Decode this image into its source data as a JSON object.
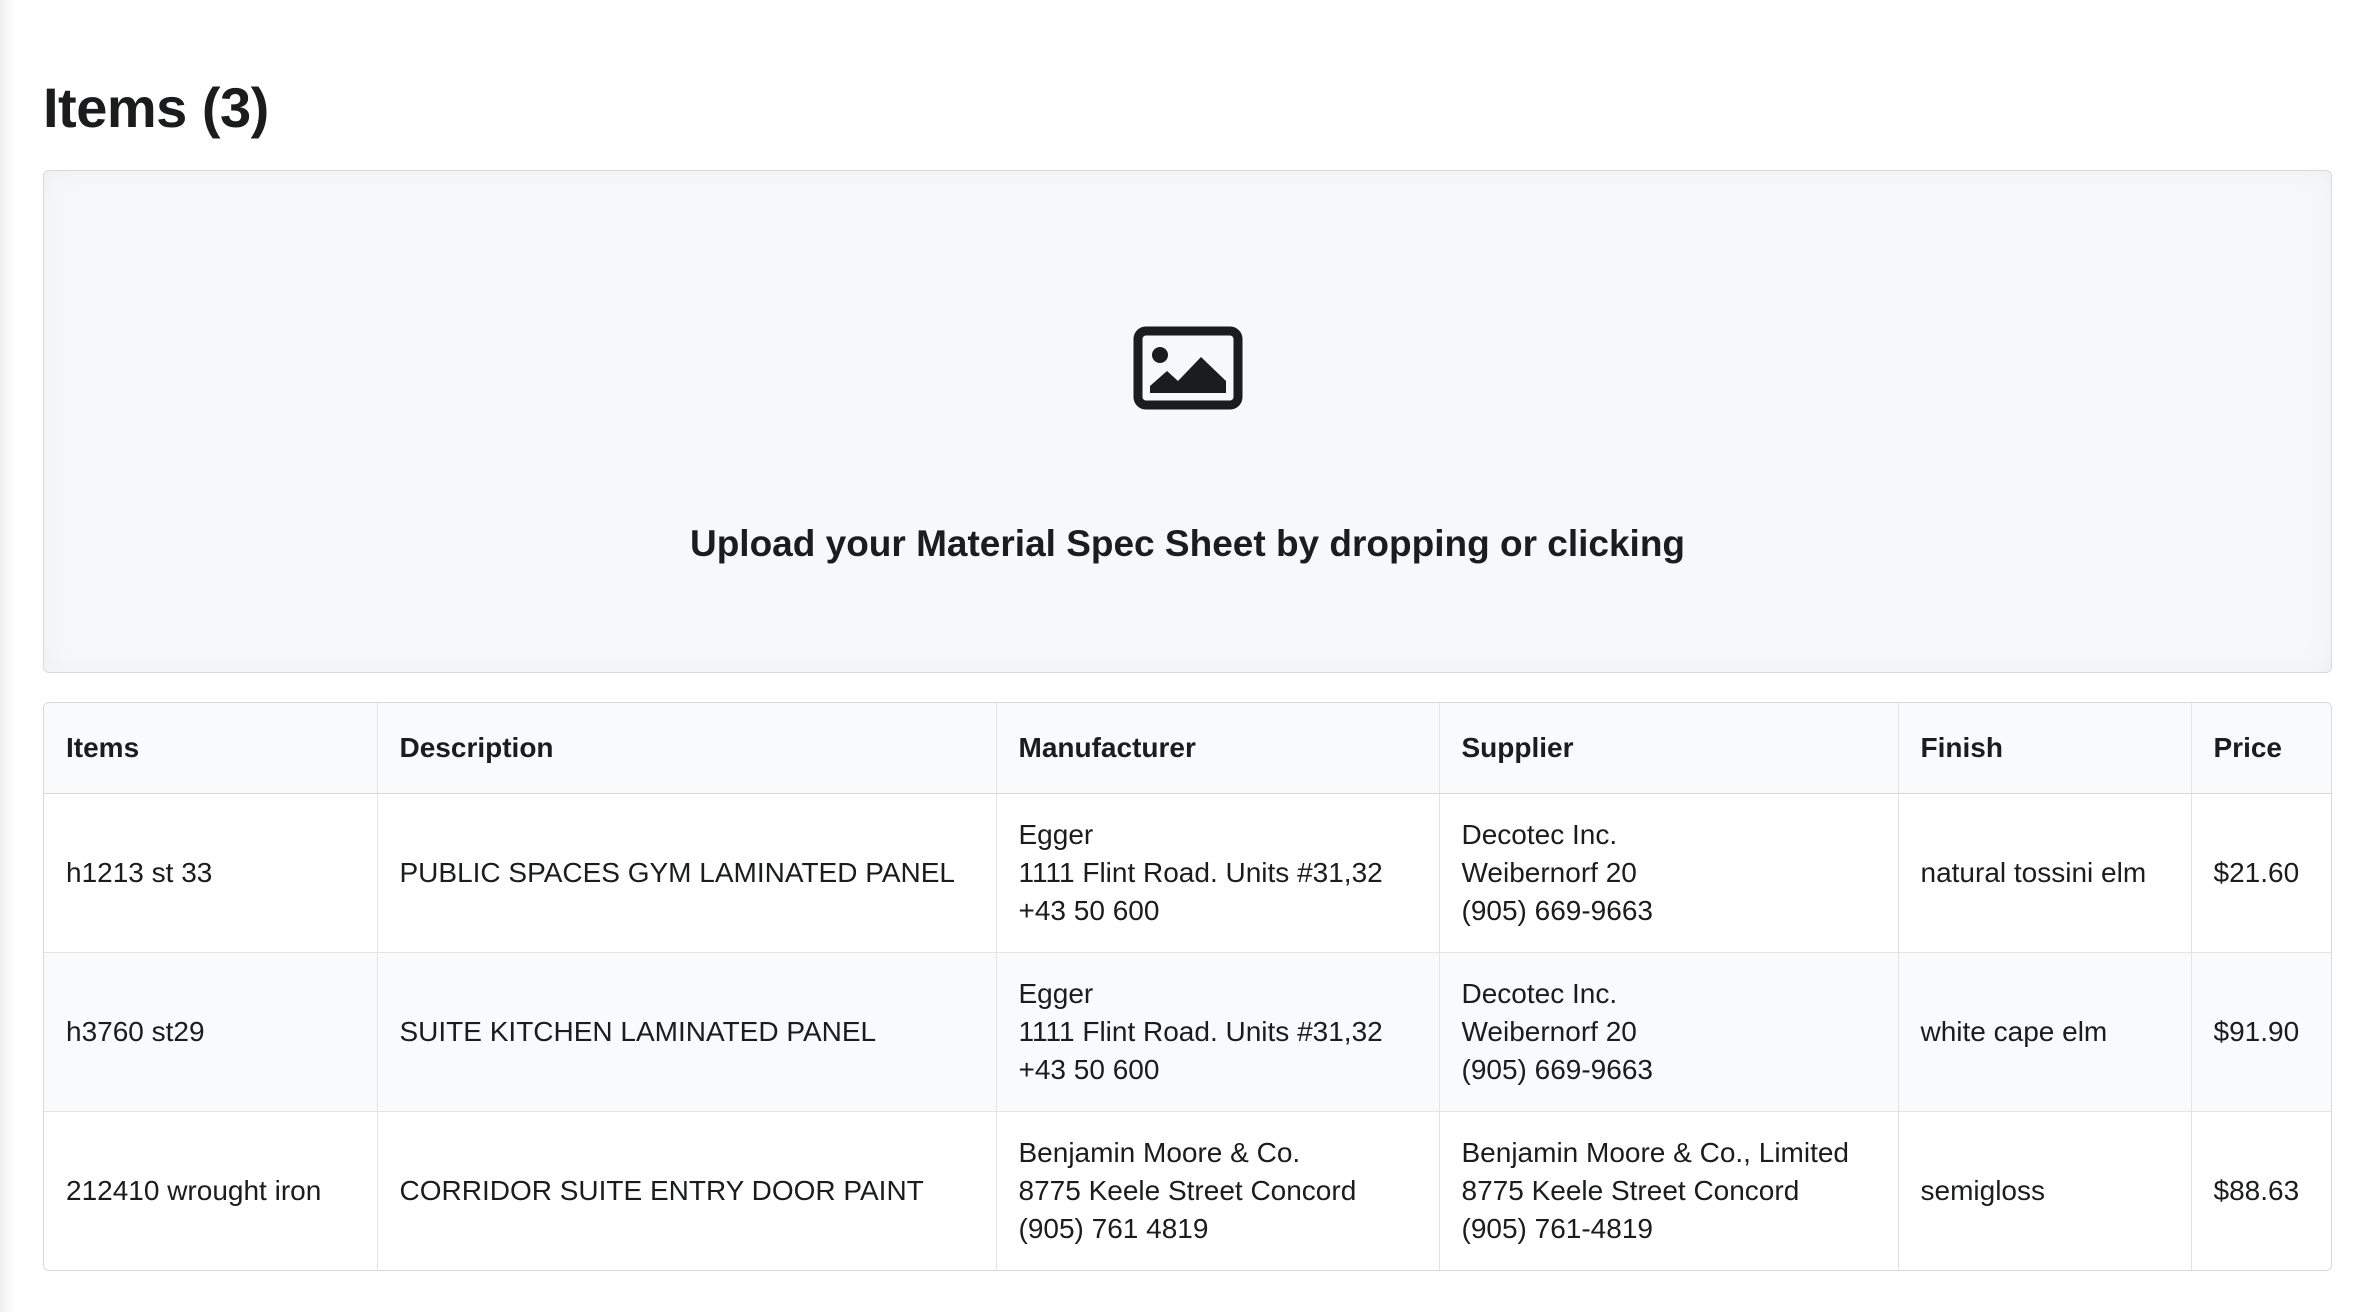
{
  "page": {
    "title": "Items (3)"
  },
  "dropzone": {
    "icon": "image-icon",
    "text": "Upload your Material Spec Sheet by dropping or clicking"
  },
  "table": {
    "columns": [
      "Items",
      "Description",
      "Manufacturer",
      "Supplier",
      "Finish",
      "Price"
    ],
    "rows": [
      {
        "item": "h1213 st 33",
        "description": "PUBLIC SPACES GYM LAMINATED PANEL",
        "manufacturer": [
          "Egger",
          "1111 Flint Road. Units #31,32",
          "+43 50 600"
        ],
        "supplier": [
          "Decotec Inc.",
          "Weibernorf 20",
          "(905) 669-9663"
        ],
        "finish": "natural tossini elm",
        "price": "$21.60"
      },
      {
        "item": "h3760 st29",
        "description": "SUITE KITCHEN LAMINATED PANEL",
        "manufacturer": [
          "Egger",
          "1111 Flint Road. Units #31,32",
          "+43 50 600"
        ],
        "supplier": [
          "Decotec Inc.",
          "Weibernorf 20",
          "(905) 669-9663"
        ],
        "finish": "white cape elm",
        "price": "$91.90"
      },
      {
        "item": "212410 wrought iron",
        "description": "CORRIDOR SUITE ENTRY DOOR PAINT",
        "manufacturer": [
          "Benjamin Moore & Co.",
          "8775 Keele Street Concord",
          "(905) 761 4819"
        ],
        "supplier": [
          "Benjamin Moore & Co., Limited",
          "8775 Keele Street Concord",
          "(905) 761-4819"
        ],
        "finish": "semigloss",
        "price": "$88.63"
      }
    ]
  }
}
